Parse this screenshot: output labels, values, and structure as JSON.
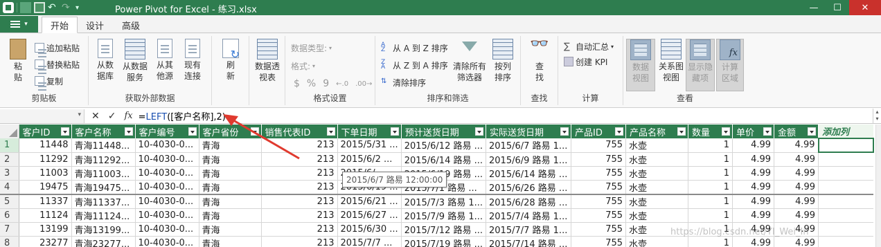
{
  "window": {
    "title": "Power Pivot for Excel - 练习.xlsx",
    "minimize": "—",
    "maximize": "☐",
    "close": "✕"
  },
  "tabs": [
    {
      "label": "开始",
      "active": true
    },
    {
      "label": "设计",
      "active": false
    },
    {
      "label": "高级",
      "active": false
    }
  ],
  "ribbon": {
    "clipboard": {
      "label": "剪贴板",
      "paste": "粘\n贴",
      "append_paste": "追加粘贴",
      "replace_paste": "替换粘贴",
      "copy": "复制"
    },
    "external": {
      "label": "获取外部数据",
      "from_db": "从数\n据库",
      "from_service": "从数据\n服务",
      "from_other": "从其\n他源",
      "existing": "现有\n连接"
    },
    "refresh": {
      "label": "刷\n新"
    },
    "pivot": {
      "label": "数据透\n视表"
    },
    "format": {
      "label": "格式设置",
      "data_type": "数据类型:",
      "format": "格式:",
      "currency": "$",
      "percent": "%",
      "comma": "9"
    },
    "sort": {
      "label": "排序和筛选",
      "a_to_z": "从 A 到 Z 排序",
      "z_to_a": "从 Z 到 A 排序",
      "clear_sort": "清除排序",
      "clear_filters": "清除所有\n筛选器",
      "sort_by_col": "按列\n排序"
    },
    "find": {
      "label": "查找",
      "find": "查\n找"
    },
    "calc": {
      "label": "计算",
      "autosum": "自动汇总",
      "create_kpi": "创建 KPI"
    },
    "view": {
      "label": "查看",
      "data_view": "数据\n视图",
      "diagram_view": "关系图\n视图",
      "show_hidden": "显示隐\n藏项",
      "calc_area": "计算\n区域"
    }
  },
  "formula_bar": {
    "cancel": "✕",
    "enter": "✓",
    "fx": "fx",
    "prefix": "=",
    "function": "LEFT",
    "args": "([客户名称],2)"
  },
  "table": {
    "columns": [
      "客户ID",
      "客户名称",
      "客户编号",
      "客户省份",
      "销售代表ID",
      "下单日期",
      "预计送货日期",
      "实际送货日期",
      "产品ID",
      "产品名称",
      "数量",
      "单价",
      "金额"
    ],
    "add_column": "添加列",
    "rows": [
      [
        "1",
        "11448",
        "青海11448...",
        "10-4030-0...",
        "青海",
        "213",
        "2015/5/31 ...",
        "2015/6/12 路易 ...",
        "2015/6/7 路易 1...",
        "755",
        "水壶",
        "1",
        "4.99",
        "4.99"
      ],
      [
        "2",
        "11292",
        "青海11292...",
        "10-4030-0...",
        "青海",
        "213",
        "2015/6/2 ...",
        "2015/6/14 路易 ...",
        "2015/6/9 路易 1...",
        "755",
        "水壶",
        "1",
        "4.99",
        "4.99"
      ],
      [
        "3",
        "11003",
        "青海11003...",
        "10-4030-0...",
        "青海",
        "213",
        "2015/6/...",
        "2015/6/19 路易 ...",
        "2015/6/14 路易 ...",
        "755",
        "水壶",
        "1",
        "4.99",
        "4.99"
      ],
      [
        "4",
        "19475",
        "青海19475...",
        "10-4030-0...",
        "青海",
        "213",
        "2015/6/19 ...",
        "2015/7/1 路易 ...",
        "2015/6/26 路易 ...",
        "755",
        "水壶",
        "1",
        "4.99",
        "4.99"
      ],
      [
        "5",
        "11337",
        "青海11337...",
        "10-4030-0...",
        "青海",
        "213",
        "2015/6/21 ...",
        "2015/7/3 路易 1...",
        "2015/6/28 路易 ...",
        "755",
        "水壶",
        "1",
        "4.99",
        "4.99"
      ],
      [
        "6",
        "11124",
        "青海11124...",
        "10-4030-0...",
        "青海",
        "213",
        "2015/6/27 ...",
        "2015/7/9 路易 1...",
        "2015/7/4 路易 1...",
        "755",
        "水壶",
        "1",
        "4.99",
        "4.99"
      ],
      [
        "7",
        "13199",
        "青海13199...",
        "10-4030-0...",
        "青海",
        "213",
        "2015/6/30 ...",
        "2015/7/12 路易 ...",
        "2015/7/7 路易 1...",
        "755",
        "水壶",
        "1",
        "4.99",
        "4.99"
      ],
      [
        "8",
        "23277",
        "青海23277...",
        "10-4030-0...",
        "青海",
        "213",
        "2015/7/7 ...",
        "2015/7/19 路易 ...",
        "2015/7/14 路易 ...",
        "755",
        "水壶",
        "1",
        "4.99",
        "4.99"
      ]
    ]
  },
  "tooltip": "2015/6/7 路易 12:00:00",
  "watermark": "https://blog.csdn.net/YI_Wei_In",
  "annotation": {
    "arrow_color": "#e03a2f"
  }
}
